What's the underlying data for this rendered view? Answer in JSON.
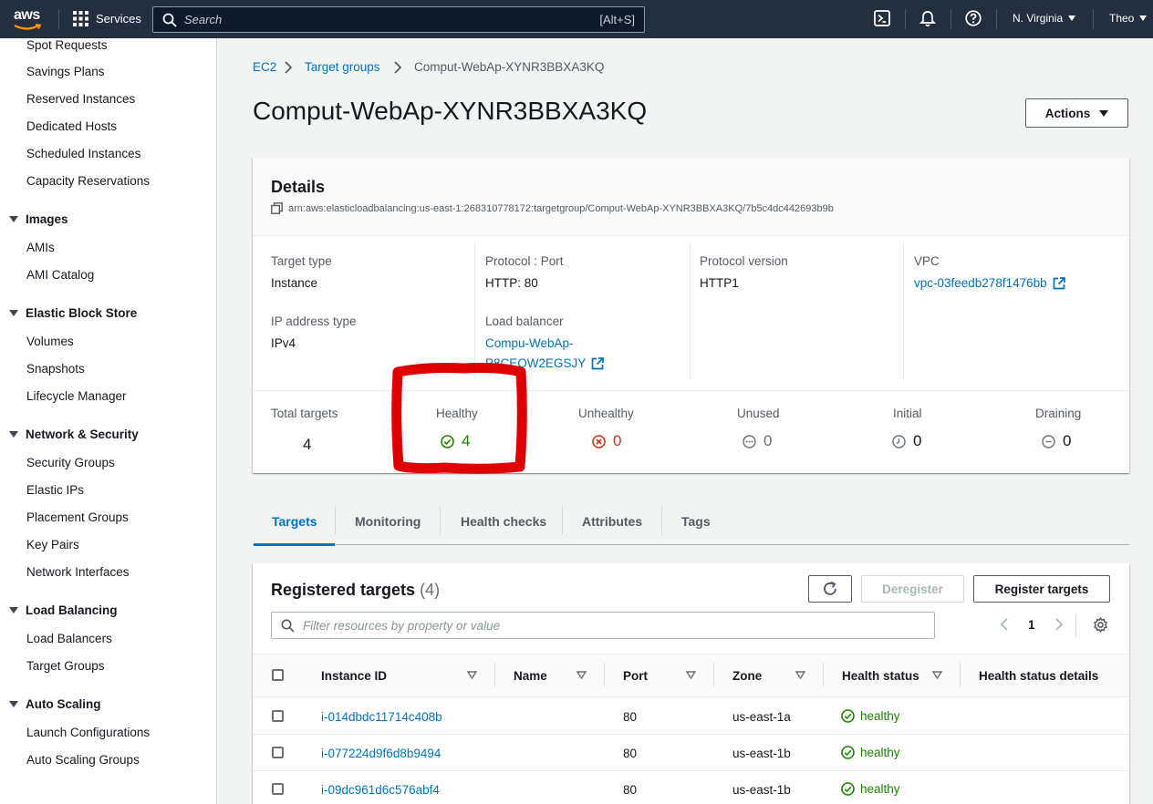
{
  "topnav": {
    "logo_text": "aws",
    "services_label": "Services",
    "search_placeholder": "Search",
    "search_shortcut": "[Alt+S]",
    "region": "N. Virginia",
    "user": "Theo"
  },
  "sidebar": {
    "items_top": [
      "Spot Requests",
      "Savings Plans",
      "Reserved Instances",
      "Dedicated Hosts",
      "Scheduled Instances",
      "Capacity Reservations"
    ],
    "images": {
      "title": "Images",
      "items": [
        "AMIs",
        "AMI Catalog"
      ]
    },
    "ebs": {
      "title": "Elastic Block Store",
      "items": [
        "Volumes",
        "Snapshots",
        "Lifecycle Manager"
      ]
    },
    "network": {
      "title": "Network & Security",
      "items": [
        "Security Groups",
        "Elastic IPs",
        "Placement Groups",
        "Key Pairs",
        "Network Interfaces"
      ]
    },
    "lb": {
      "title": "Load Balancing",
      "items": [
        "Load Balancers",
        "Target Groups"
      ]
    },
    "asg": {
      "title": "Auto Scaling",
      "items": [
        "Launch Configurations",
        "Auto Scaling Groups"
      ]
    }
  },
  "breadcrumb": [
    "EC2",
    "Target groups",
    "Comput-WebAp-XYNR3BBXA3KQ"
  ],
  "page_title": "Comput-WebAp-XYNR3BBXA3KQ",
  "actions_label": "Actions",
  "details": {
    "title": "Details",
    "arn": "arn:aws:elasticloadbalancing:us-east-1:268310778172:targetgroup/Comput-WebAp-XYNR3BBXA3KQ/7b5c4dc442693b9b",
    "target_type_label": "Target type",
    "target_type": "Instance",
    "protocol_port_label": "Protocol : Port",
    "protocol_port": "HTTP: 80",
    "protocol_version_label": "Protocol version",
    "protocol_version": "HTTP1",
    "vpc_label": "VPC",
    "vpc": "vpc-03feedb278f1476bb",
    "ip_type_label": "IP address type",
    "ip_type": "IPv4",
    "lb_label": "Load balancer",
    "lb_line1": "Compu-WebAp-",
    "lb_line2": "P8CEOW2EGSJY"
  },
  "counts": {
    "total_label": "Total targets",
    "total": "4",
    "healthy_label": "Healthy",
    "healthy": "4",
    "unhealthy_label": "Unhealthy",
    "unhealthy": "0",
    "unused_label": "Unused",
    "unused": "0",
    "initial_label": "Initial",
    "initial": "0",
    "draining_label": "Draining",
    "draining": "0"
  },
  "tabs": [
    "Targets",
    "Monitoring",
    "Health checks",
    "Attributes",
    "Tags"
  ],
  "registered": {
    "title": "Registered targets",
    "count": "(4)",
    "deregister_label": "Deregister",
    "register_label": "Register targets",
    "filter_placeholder": "Filter resources by property or value",
    "page": "1",
    "columns": [
      "Instance ID",
      "Name",
      "Port",
      "Zone",
      "Health status",
      "Health status details"
    ],
    "rows": [
      {
        "id": "i-014dbdc11714c408b",
        "name": "",
        "port": "80",
        "zone": "us-east-1a",
        "status": "healthy"
      },
      {
        "id": "i-077224d9f6d8b9494",
        "name": "",
        "port": "80",
        "zone": "us-east-1b",
        "status": "healthy"
      },
      {
        "id": "i-09dc961d6c576abf4",
        "name": "",
        "port": "80",
        "zone": "us-east-1b",
        "status": "healthy"
      }
    ]
  },
  "colors": {
    "nav_bg": "#232f3e",
    "link": "#0073bb",
    "success": "#1d8102",
    "error": "#d13212",
    "annotation": "#e00000"
  }
}
